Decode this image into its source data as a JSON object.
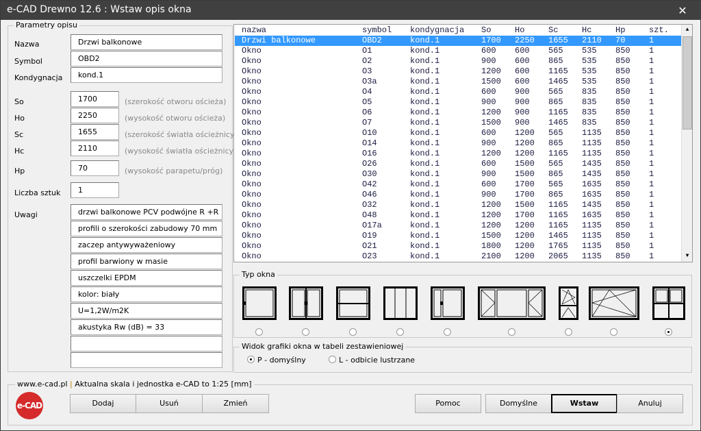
{
  "window": {
    "title": "e-CAD Drewno 12.6 : Wstaw opis okna",
    "close": "✕"
  },
  "params": {
    "legend": "Parametry opisu",
    "nazwa_label": "Nazwa",
    "nazwa": "Drzwi balkonowe",
    "symbol_label": "Symbol",
    "symbol": "OBD2",
    "kond_label": "Kondygnacja",
    "kond": "kond.1",
    "dims": [
      {
        "label": "So",
        "value": "1700",
        "hint": "(szerokość otworu ościeża)"
      },
      {
        "label": "Ho",
        "value": "2250",
        "hint": "(wysokość otworu ościeża)"
      },
      {
        "label": "Sc",
        "value": "1655",
        "hint": "(szerokość światła ościeżnicy)"
      },
      {
        "label": "Hc",
        "value": "2110",
        "hint": "(wysokość światła ościeżnicy)"
      }
    ],
    "hp_label": "Hp",
    "hp": "70",
    "hp_hint": "(wysokość parapetu/próg)",
    "liczba_label": "Liczba sztuk",
    "liczba": "1",
    "uwagi_label": "Uwagi",
    "uwagi": [
      "drzwi balkonowe PCV podwójne R +R",
      "profili o szerokości zabudowy 70 mm",
      "zaczep antywyważeniowy",
      "profil barwiony w masie",
      "uszczelki EPDM",
      "kolor: biały",
      "U=1,2W/m2K",
      "akustyka Rw (dB) = 33",
      "",
      ""
    ]
  },
  "table": {
    "headers": [
      "nazwa",
      "symbol",
      "kondygnacja",
      "So",
      "Ho",
      "Sc",
      "Hc",
      "Hp",
      "szt."
    ],
    "selected_index": 0,
    "rows": [
      [
        "Drzwi balkonowe",
        "OBD2",
        "kond.1",
        "1700",
        "2250",
        "1655",
        "2110",
        "70",
        "1"
      ],
      [
        "Okno",
        "O1",
        "kond.1",
        "600",
        "600",
        "565",
        "535",
        "850",
        "1"
      ],
      [
        "Okno",
        "O2",
        "kond.1",
        "900",
        "600",
        "865",
        "535",
        "850",
        "1"
      ],
      [
        "Okno",
        "O3",
        "kond.1",
        "1200",
        "600",
        "1165",
        "535",
        "850",
        "1"
      ],
      [
        "Okno",
        "O3a",
        "kond.1",
        "1500",
        "600",
        "1465",
        "535",
        "850",
        "1"
      ],
      [
        "Okno",
        "O4",
        "kond.1",
        "600",
        "900",
        "565",
        "835",
        "850",
        "1"
      ],
      [
        "Okno",
        "O5",
        "kond.1",
        "900",
        "900",
        "865",
        "835",
        "850",
        "1"
      ],
      [
        "Okno",
        "O6",
        "kond.1",
        "1200",
        "900",
        "1165",
        "835",
        "850",
        "1"
      ],
      [
        "Okno",
        "O7",
        "kond.1",
        "1500",
        "900",
        "1465",
        "835",
        "850",
        "1"
      ],
      [
        "Okno",
        "O10",
        "kond.1",
        "600",
        "1200",
        "565",
        "1135",
        "850",
        "1"
      ],
      [
        "Okno",
        "O14",
        "kond.1",
        "900",
        "1200",
        "865",
        "1135",
        "850",
        "1"
      ],
      [
        "Okno",
        "O16",
        "kond.1",
        "1200",
        "1200",
        "1165",
        "1135",
        "850",
        "1"
      ],
      [
        "Okno",
        "O26",
        "kond.1",
        "600",
        "1500",
        "565",
        "1435",
        "850",
        "1"
      ],
      [
        "Okno",
        "O30",
        "kond.1",
        "900",
        "1500",
        "865",
        "1435",
        "850",
        "1"
      ],
      [
        "Okno",
        "O42",
        "kond.1",
        "600",
        "1700",
        "565",
        "1635",
        "850",
        "1"
      ],
      [
        "Okno",
        "O46",
        "kond.1",
        "900",
        "1700",
        "865",
        "1635",
        "850",
        "1"
      ],
      [
        "Okno",
        "O32",
        "kond.1",
        "1200",
        "1500",
        "1165",
        "1435",
        "850",
        "1"
      ],
      [
        "Okno",
        "O48",
        "kond.1",
        "1200",
        "1700",
        "1165",
        "1635",
        "850",
        "1"
      ],
      [
        "Okno",
        "O17a",
        "kond.1",
        "1200",
        "1200",
        "1165",
        "1135",
        "850",
        "1"
      ],
      [
        "Okno",
        "O19",
        "kond.1",
        "1500",
        "1200",
        "1465",
        "1135",
        "850",
        "1"
      ],
      [
        "Okno",
        "O21",
        "kond.1",
        "1800",
        "1200",
        "1765",
        "1135",
        "850",
        "1"
      ],
      [
        "Okno",
        "O23",
        "kond.1",
        "2100",
        "1200",
        "2065",
        "1135",
        "850",
        "1"
      ]
    ]
  },
  "typ_okna": {
    "legend": "Typ okna",
    "selected_index": 8,
    "types": [
      "single-sash",
      "double-sash",
      "transom",
      "triple-panel",
      "narrow-wide-sash",
      "tilt-fixed-tilt",
      "tilt-over-tilt",
      "tilt-turn-large",
      "four-panel"
    ]
  },
  "widok": {
    "legend": "Widok grafiki okna w tabeli zestawieniowej",
    "options": [
      "P - domyślny",
      "L - odbicie lustrzane"
    ],
    "selected_index": 0
  },
  "footer": {
    "legend_link": "www.e-cad.pl",
    "legend_sep": " | ",
    "legend_text": "Aktualna skala i jednostka e-CAD to 1:25 [mm]",
    "logo": "e-CAD",
    "buttons": {
      "dodaj": "Dodaj",
      "usun": "Usuń",
      "zmien": "Zmień",
      "pomoc": "Pomoc",
      "domyslne": "Domyślne",
      "wstaw": "Wstaw",
      "anuluj": "Anuluj"
    }
  },
  "colors": {
    "selection": "#3399ff",
    "titlebar": "#404040",
    "logo": "#d52b2b"
  }
}
